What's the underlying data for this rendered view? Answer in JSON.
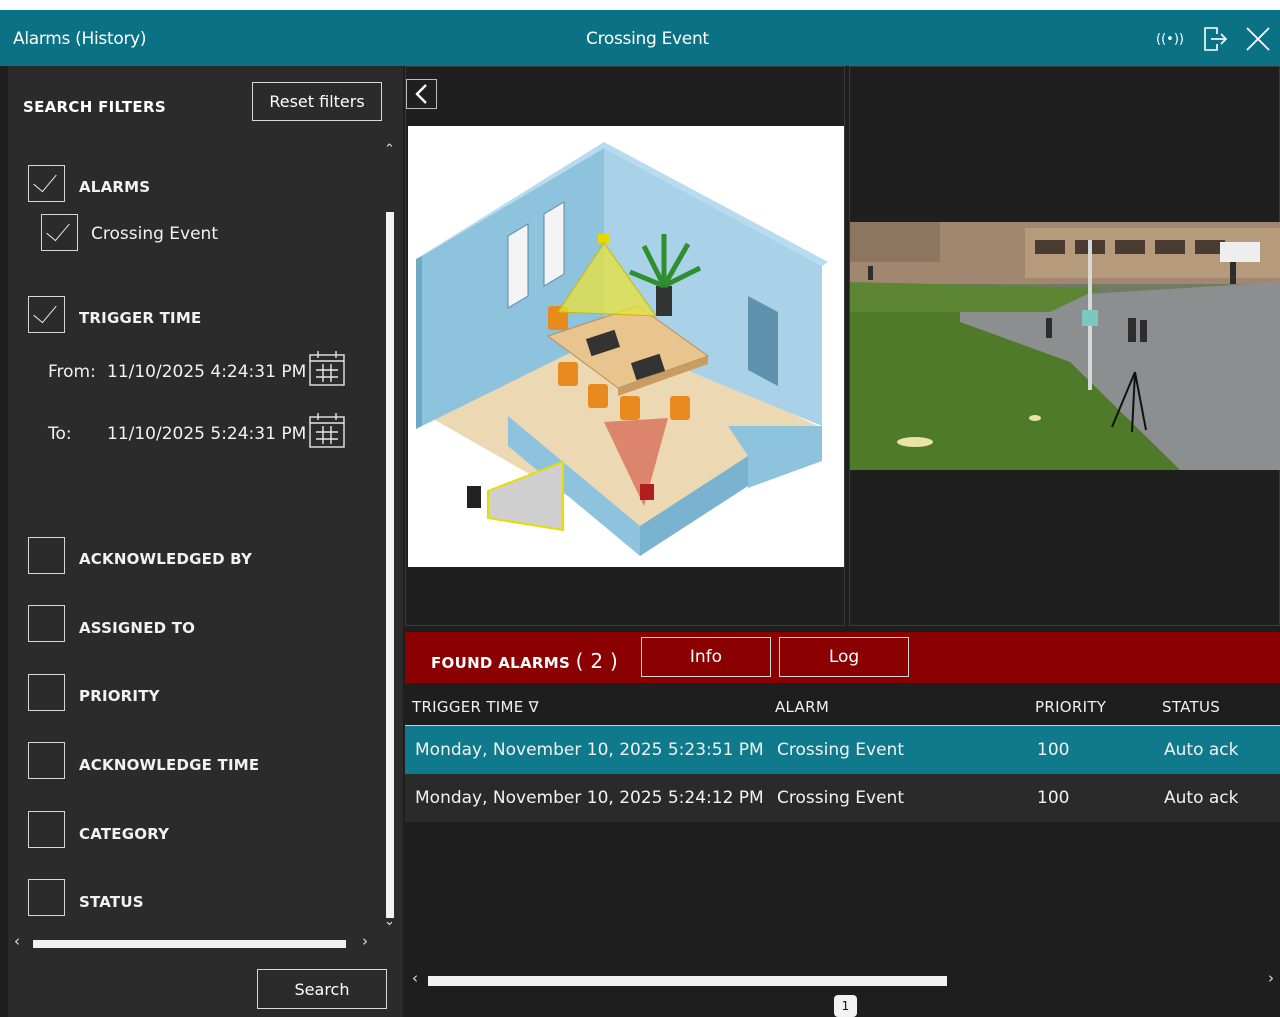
{
  "titlebar": {
    "left_title": "Alarms (History)",
    "center_title": "Crossing Event",
    "signal_icon_text": "((•))"
  },
  "filters": {
    "header": "SEARCH FILTERS",
    "reset_label": "Reset filters",
    "search_label": "Search",
    "alarms": {
      "label": "ALARMS",
      "checked": true,
      "sub_label": "Crossing Event",
      "sub_checked": true
    },
    "trigger_time": {
      "label": "TRIGGER TIME",
      "checked": true,
      "from_label": "From:",
      "from_value": "11/10/2025 4:24:31 PM",
      "to_label": "To:",
      "to_value": "11/10/2025 5:24:31 PM"
    },
    "other": [
      {
        "label": "ACKNOWLEDGED BY",
        "checked": false
      },
      {
        "label": "ASSIGNED TO",
        "checked": false
      },
      {
        "label": "PRIORITY",
        "checked": false
      },
      {
        "label": "ACKNOWLEDGE TIME",
        "checked": false
      },
      {
        "label": "CATEGORY",
        "checked": false
      },
      {
        "label": "STATUS",
        "checked": false
      }
    ]
  },
  "found": {
    "label": "FOUND ALARMS",
    "count": "( 2 )",
    "tabs": {
      "info": "Info",
      "log": "Log"
    }
  },
  "table": {
    "headers": {
      "trigger_time": "TRIGGER TIME ∇",
      "alarm": "ALARM",
      "priority": "PRIORITY",
      "status": "STATUS"
    },
    "rows": [
      {
        "trigger_time": "Monday, November 10, 2025 5:23:51 PM",
        "alarm": "Crossing Event",
        "priority": "100",
        "status": "Auto ack"
      },
      {
        "trigger_time": "Monday, November 10, 2025 5:24:12 PM",
        "alarm": "Crossing Event",
        "priority": "100",
        "status": "Auto ack"
      }
    ],
    "selected_row": 0
  },
  "pagination": {
    "current_page": "1"
  },
  "colors": {
    "titlebar": "#0b7285",
    "found_bar": "#8b0000",
    "selected_row": "#0f7a8c",
    "panel_bg": "#2b2b2b"
  }
}
